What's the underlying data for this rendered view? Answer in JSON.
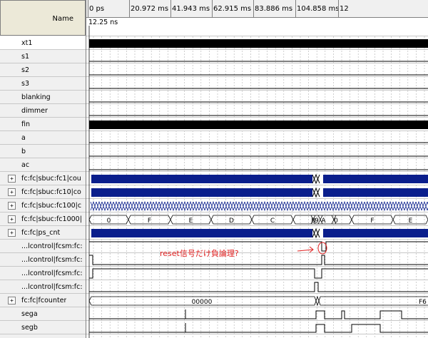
{
  "names_header": "Name",
  "timeline": {
    "ticks": [
      "0 ps",
      "20.972 ms",
      "41.943 ms",
      "62.915 ms",
      "83.886 ms",
      "104.858 ms",
      "12"
    ]
  },
  "cursor": {
    "readout": "12.25 ns"
  },
  "signals": [
    {
      "name": "xt1",
      "expandable": false,
      "selected": true
    },
    {
      "name": "s1",
      "expandable": false
    },
    {
      "name": "s2",
      "expandable": false
    },
    {
      "name": "s3",
      "expandable": false
    },
    {
      "name": "blanking",
      "expandable": false
    },
    {
      "name": "dimmer",
      "expandable": false
    },
    {
      "name": "fin",
      "expandable": false
    },
    {
      "name": "a",
      "expandable": false
    },
    {
      "name": "b",
      "expandable": false
    },
    {
      "name": "ac",
      "expandable": false
    },
    {
      "name": "fc:fc|sbuc:fc1|cou",
      "expandable": true
    },
    {
      "name": "fc:fc|sbuc:fc10|co",
      "expandable": true
    },
    {
      "name": "fc:fc|sbuc:fc100|c",
      "expandable": true
    },
    {
      "name": "fc:fc|sbuc:fc1000|",
      "expandable": true
    },
    {
      "name": "fc:fc|ps_cnt",
      "expandable": true
    },
    {
      "name": "...lcontrol|fcsm:fc:",
      "expandable": false
    },
    {
      "name": "...lcontrol|fcsm:fc:",
      "expandable": false
    },
    {
      "name": "...lcontrol|fcsm:fc:",
      "expandable": false
    },
    {
      "name": "...lcontrol|fcsm:fc:",
      "expandable": false
    },
    {
      "name": "fc:fc|fcounter",
      "expandable": true
    },
    {
      "name": "sega",
      "expandable": false
    },
    {
      "name": "segb",
      "expandable": false
    }
  ],
  "bus_values": {
    "fc1000": [
      "0",
      "F",
      "E",
      "D",
      "C",
      "B",
      "A",
      "9",
      "0",
      "0",
      "F",
      "E"
    ],
    "fcounter": [
      "00000",
      "F6"
    ]
  },
  "annotation": {
    "text": "reset信号だけ負論理?",
    "color": "#e02020"
  },
  "icons": {
    "expand": "plus-box-icon"
  },
  "colors": {
    "bus_fill": "#0a1e8c",
    "signal_line": "#000000"
  }
}
